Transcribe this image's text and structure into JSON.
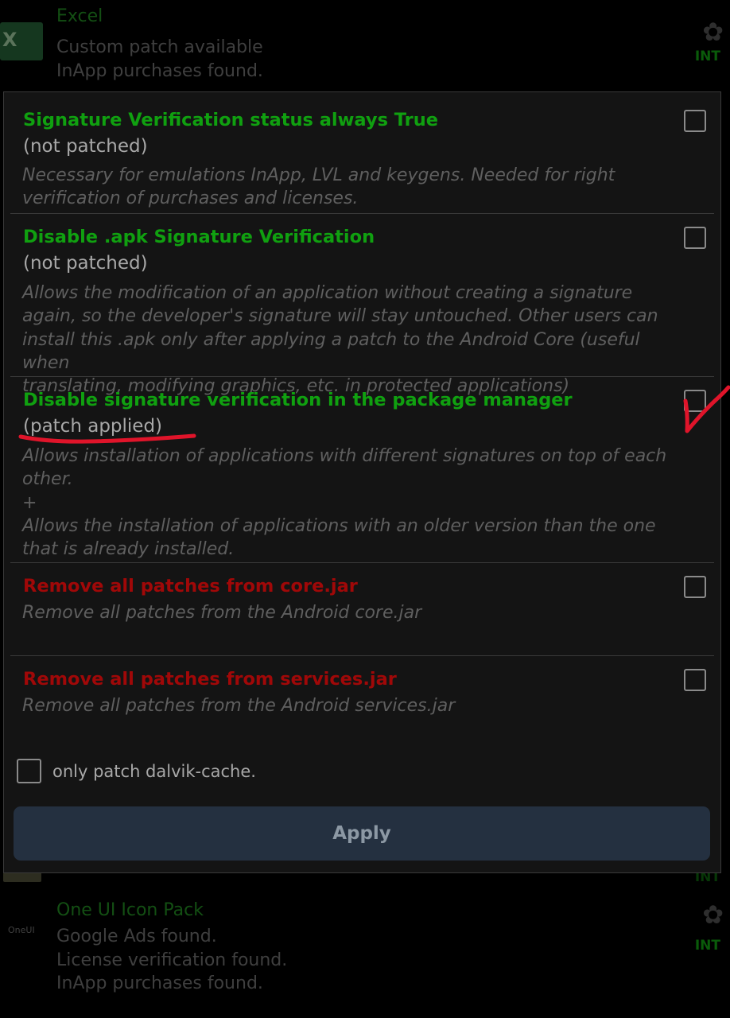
{
  "background_list": {
    "top_app": {
      "icon": "excel-icon",
      "icon_letter": "X",
      "name": "Excel",
      "lines": [
        "Custom patch available",
        "InApp purchases found."
      ],
      "badge": "INT"
    },
    "middle_badge": "INT",
    "bottom_app": {
      "icon": "oneui-icon",
      "icon_label": "OneUI",
      "name": "One UI Icon Pack",
      "lines": [
        "Google Ads found.",
        "License verification found.",
        "InApp purchases found."
      ],
      "badge": "INT"
    }
  },
  "dialog": {
    "items": [
      {
        "title": "Signature Verification status always True",
        "status": "(not patched)",
        "description": "Necessary for emulations InApp, LVL and keygens. Needed for right\nverification of purchases and licenses.",
        "color": "#10a010",
        "checked": false
      },
      {
        "title": "Disable .apk Signature Verification",
        "status": "(not patched)",
        "description": "Allows the modification of an application without creating a signature\nagain, so the developer's signature will stay untouched. Other users can\ninstall this .apk only after applying a patch to the Android Core (useful when\ntranslating, modifying graphics, etc. in protected applications)",
        "color": "#10a010",
        "checked": false
      },
      {
        "title": "Disable signature verification in the package manager",
        "status": "(patch applied)",
        "description": "Allows installation of applications with different signatures on top of each\nother.\n+\nAllows the installation of applications with an older version than the one\nthat is already installed.",
        "color": "#10a010",
        "checked": false
      },
      {
        "title": "Remove all patches from core.jar",
        "description": "Remove all patches from the Android core.jar",
        "color": "#a00808",
        "checked": false
      },
      {
        "title": "Remove all patches from services.jar",
        "description": "Remove all patches from the Android services.jar",
        "color": "#a00808",
        "checked": false
      }
    ],
    "dalvik_option": {
      "label": "only patch dalvik-cache.",
      "checked": false
    },
    "apply_label": "Apply"
  },
  "annotations": {
    "color": "#e0142a"
  }
}
